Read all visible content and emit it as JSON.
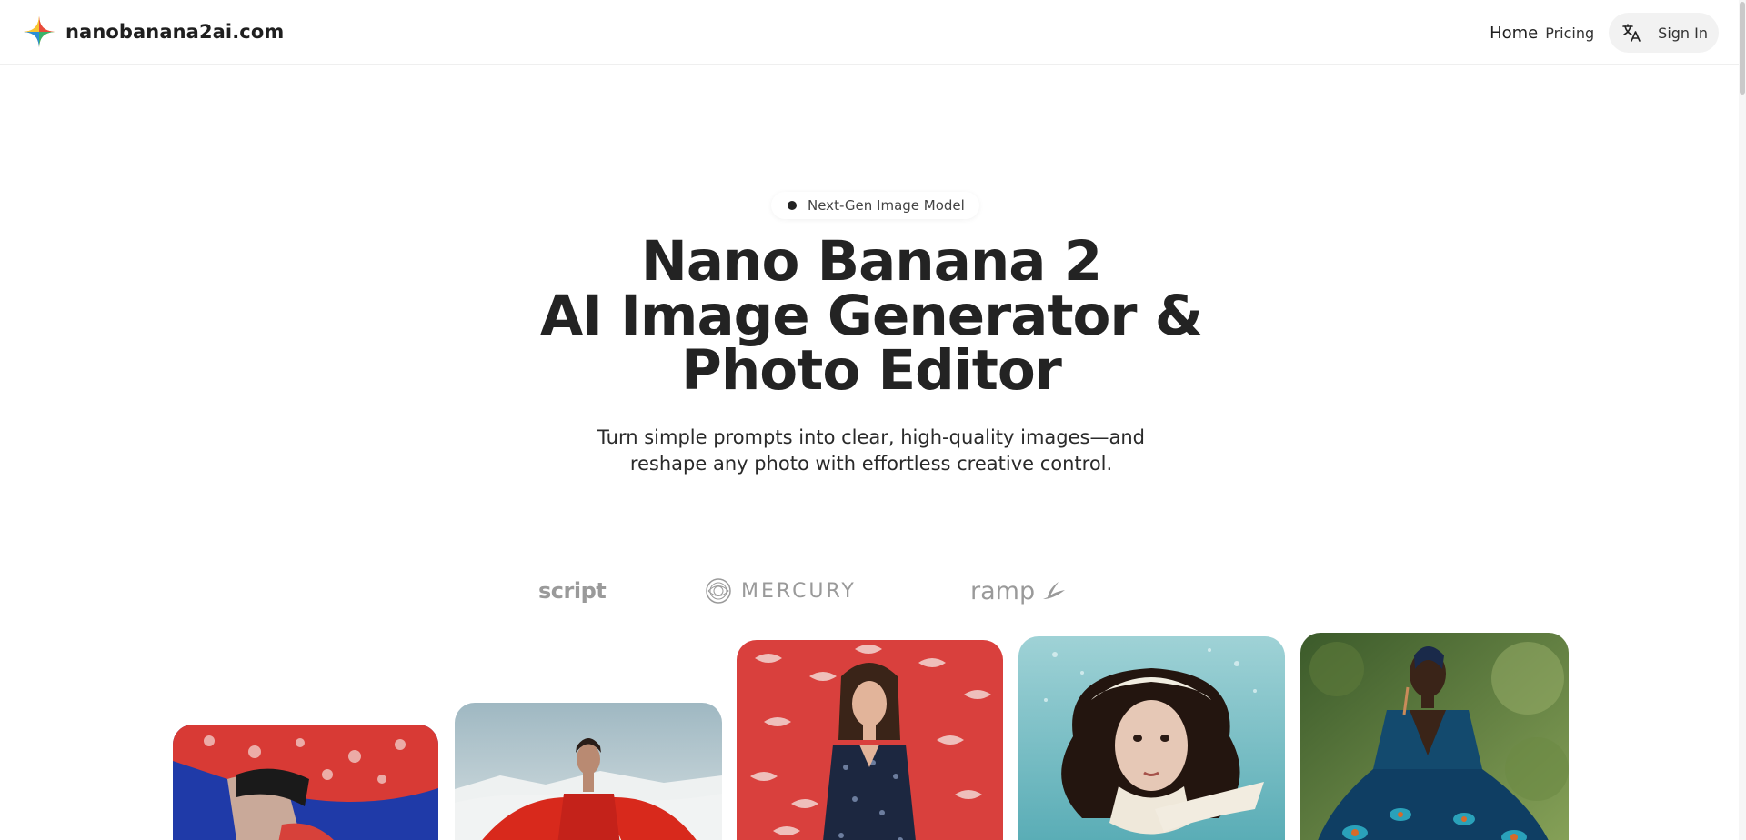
{
  "header": {
    "site_name": "nanobanana2ai.com",
    "logo_icon": "four-point-sparkle-icon",
    "nav": {
      "home": "Home",
      "pricing": "Pricing",
      "translate_icon": "translate-icon",
      "sign_in": "Sign In"
    }
  },
  "hero": {
    "badge": "Next-Gen Image Model",
    "title_lines": [
      "Nano Banana 2",
      "AI Image Generator &",
      "Photo Editor"
    ],
    "subtitle_lines": [
      "Turn simple prompts into clear, high-quality images—and",
      "reshape any photo with effortless creative control."
    ]
  },
  "logos": {
    "script": "script",
    "mercury": "MERCURY",
    "ramp": "ramp"
  },
  "gallery": [
    {
      "subject": "woman with red patterned wide-brim hat on blue background"
    },
    {
      "subject": "woman in red feathered dress in snowy mountains"
    },
    {
      "subject": "woman in blue floral dress against red crane-pattern backdrop"
    },
    {
      "subject": "woman underwater with lace bonnet"
    },
    {
      "subject": "woman in blue peacock gown in forest"
    }
  ],
  "colors": {
    "text_primary": "#232323",
    "muted_logo": "#9a9a9a",
    "pill_bg": "#f2f2f2"
  }
}
